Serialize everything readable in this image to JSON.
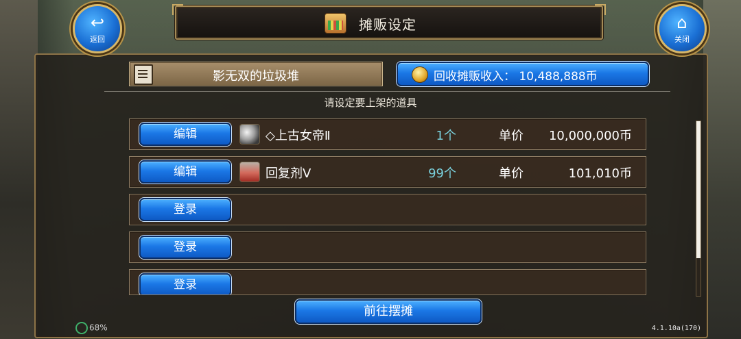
{
  "title": "摊贩设定",
  "back_button": {
    "glyph": "↩",
    "label": "返回"
  },
  "close_button": {
    "glyph": "⌂",
    "label": "关闭"
  },
  "shop_name": "影无双的垃圾堆",
  "collect_button_label": "回收摊贩收入：  10,488,888币",
  "prompt": "请设定要上架的道具",
  "rows": [
    {
      "button_label": "编辑",
      "icon": "dagger-icon",
      "item_name": "◇上古女帝Ⅱ",
      "quantity": "1个",
      "price_label": "单价",
      "price": "10,000,000币"
    },
    {
      "button_label": "编辑",
      "icon": "potion-icon",
      "item_name": "回复剂Ⅴ",
      "quantity": "99个",
      "price_label": "单价",
      "price": "101,010币"
    },
    {
      "button_label": "登录"
    },
    {
      "button_label": "登录"
    },
    {
      "button_label": "登录"
    }
  ],
  "goto_button_label": "前往摆摊",
  "status": {
    "battery": "68%",
    "version": "4.1.10a(170)"
  }
}
